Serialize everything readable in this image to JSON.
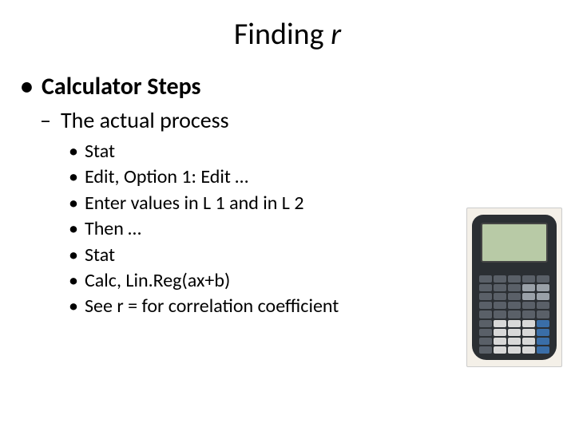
{
  "title_prefix": "Finding ",
  "title_var": "r",
  "heading_l1": "Calculator Steps",
  "heading_l2": "The actual process",
  "steps": [
    "Stat",
    "Edit, Option 1: Edit …",
    "Enter values in L 1 and in L 2",
    "Then …",
    "Stat",
    "Calc, Lin.Reg(ax+b)",
    "See r = for correlation coefficient"
  ],
  "image_alt": "TI-84 Plus graphing calculator"
}
